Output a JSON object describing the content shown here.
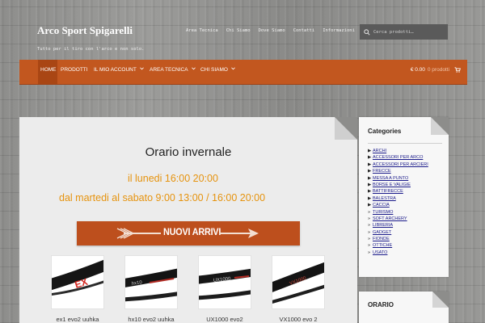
{
  "header": {
    "site_title": "Arco Sport Spigarelli",
    "tagline": "Tutto per il tiro con l'arco e non solo.",
    "top_links": [
      "Area Tecnica",
      "Chi Siamo",
      "Dove Siamo",
      "Contatti",
      "Informazioni"
    ],
    "search": {
      "placeholder": "Cerca prodotti…",
      "icon": "search-icon"
    }
  },
  "nav": {
    "items": [
      {
        "label": "Home",
        "active": true,
        "dropdown": false
      },
      {
        "label": "Prodotti",
        "active": false,
        "dropdown": false
      },
      {
        "label": "Il mio account",
        "active": false,
        "dropdown": true
      },
      {
        "label": "Area tecnica",
        "active": false,
        "dropdown": true
      },
      {
        "label": "Chi Siamo",
        "active": false,
        "dropdown": true
      }
    ],
    "cart": {
      "amount": "€ 0.00",
      "count": "0 prodotti",
      "icon": "cart-icon"
    },
    "colors": {
      "bar": "#c2571f",
      "active": "#a94614"
    }
  },
  "main": {
    "headline": "Orario invernale",
    "schedule": [
      "il lunedi 16:00 20:00",
      "dal martedi al sabato 9:00 13:00 / 16:00 20:00"
    ],
    "schedule_color": "#e6930e",
    "banner": {
      "text": "NUOVI ARRIVI",
      "color": "#bd4f1d"
    },
    "products": [
      {
        "name": "ex1 evo2 uuhka",
        "graphic": "EX"
      },
      {
        "name": "hx10 evo2 uuhka",
        "graphic": "hx10"
      },
      {
        "name": "UX1000 evo2",
        "graphic": "UX1000"
      },
      {
        "name": "VX1000 evo 2",
        "graphic": "VX1000"
      }
    ]
  },
  "sidebar": {
    "categories_title": "Categories",
    "categories": [
      {
        "label": "ARCHI",
        "bullet": "▶"
      },
      {
        "label": "ACCESSORI PER ARCO",
        "bullet": "▶"
      },
      {
        "label": "ACCESSORI PER ARCIERI",
        "bullet": "▶"
      },
      {
        "label": "FRECCE",
        "bullet": "▶"
      },
      {
        "label": "MESSA A PUNTO",
        "bullet": "▶"
      },
      {
        "label": "BORSE E VALIGIE",
        "bullet": "▶"
      },
      {
        "label": "BATTIFRECCE",
        "bullet": "▶"
      },
      {
        "label": "BALESTRA",
        "bullet": "▶"
      },
      {
        "label": "CACCIA",
        "bullet": "▶"
      },
      {
        "label": "TURISMO",
        "bullet": "»"
      },
      {
        "label": "SOFT ARCHERY",
        "bullet": "»"
      },
      {
        "label": "LIBRERIA",
        "bullet": "»"
      },
      {
        "label": "GADGET",
        "bullet": "»"
      },
      {
        "label": "FIONDE",
        "bullet": "»"
      },
      {
        "label": "OTTICHE",
        "bullet": "»"
      },
      {
        "label": "USATO",
        "bullet": "»"
      }
    ],
    "second_title": "ORARIO"
  }
}
